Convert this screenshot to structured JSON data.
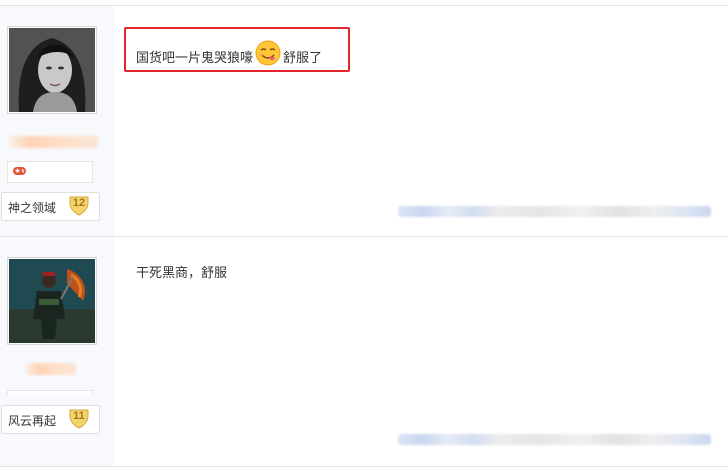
{
  "posts": [
    {
      "author_badge": "神之领域",
      "author_level": "12",
      "content": "国货吧一片鬼哭狼嚎",
      "content_suffix": "舒服了",
      "emoji": "smiley-tongue-icon"
    },
    {
      "author_badge": "风云再起",
      "author_level": "11",
      "content": "干死黑商，舒服"
    }
  ],
  "colors": {
    "highlight_border": "#e0262a",
    "sidebar_bg": "#f7f9fc",
    "badge_level_text": "#a0781f"
  }
}
